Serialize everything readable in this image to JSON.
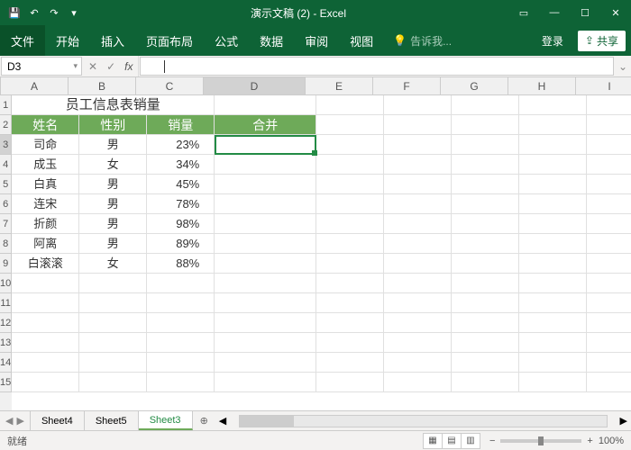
{
  "titlebar": {
    "title": "演示文稿 (2) - Excel"
  },
  "ribbon": {
    "file": "文件",
    "tabs": [
      "开始",
      "插入",
      "页面布局",
      "公式",
      "数据",
      "审阅",
      "视图"
    ],
    "tellme": "告诉我...",
    "login": "登录",
    "share": "共享"
  },
  "namebox": {
    "value": "D3"
  },
  "formula": {
    "fx": "fx"
  },
  "columns": [
    "A",
    "B",
    "C",
    "D",
    "E",
    "F",
    "G",
    "H",
    "I"
  ],
  "row_count": 15,
  "merged_title": "员工信息表销量",
  "headers": {
    "a": "姓名",
    "b": "性别",
    "c": "销量",
    "d": "合并"
  },
  "rows": [
    {
      "name": "司命",
      "gender": "男",
      "pct": "23%"
    },
    {
      "name": "成玉",
      "gender": "女",
      "pct": "34%"
    },
    {
      "name": "白真",
      "gender": "男",
      "pct": "45%"
    },
    {
      "name": "连宋",
      "gender": "男",
      "pct": "78%"
    },
    {
      "name": "折颜",
      "gender": "男",
      "pct": "98%"
    },
    {
      "name": "阿离",
      "gender": "男",
      "pct": "89%"
    },
    {
      "name": "白滚滚",
      "gender": "女",
      "pct": "88%"
    }
  ],
  "sheets": {
    "tabs": [
      "Sheet4",
      "Sheet5",
      "Sheet3"
    ],
    "active": "Sheet3"
  },
  "statusbar": {
    "ready": "就绪",
    "zoom": "100%"
  }
}
